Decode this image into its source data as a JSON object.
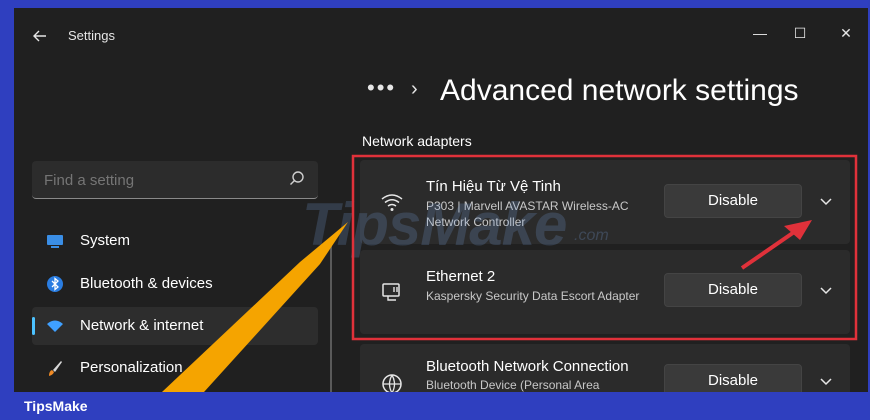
{
  "window": {
    "app_title": "Settings",
    "controls": {
      "minimize": "—",
      "maximize": "☐",
      "close": "✕"
    }
  },
  "sidebar": {
    "search_placeholder": "Find a setting",
    "items": [
      {
        "label": "System",
        "icon": "monitor-icon",
        "active": false
      },
      {
        "label": "Bluetooth & devices",
        "icon": "bluetooth-icon",
        "active": false
      },
      {
        "label": "Network & internet",
        "icon": "wifi-icon",
        "active": true
      },
      {
        "label": "Personalization",
        "icon": "brush-icon",
        "active": false
      }
    ]
  },
  "main": {
    "breadcrumb_more": "•••",
    "breadcrumb_sep": "›",
    "title": "Advanced network settings",
    "section": "Network adapters",
    "adapters": [
      {
        "name": "Tín Hiệu Từ Vệ Tinh",
        "description": "P303 | Marvell AVASTAR Wireless-AC Network Controller",
        "button": "Disable",
        "icon": "wifi-icon"
      },
      {
        "name": "Ethernet 2",
        "description": "Kaspersky Security Data Escort Adapter",
        "button": "Disable",
        "icon": "ethernet-icon"
      },
      {
        "name": "Bluetooth Network Connection",
        "description": "Bluetooth Device (Personal Area",
        "button": "Disable",
        "icon": "globe-icon"
      }
    ]
  },
  "watermark": {
    "text": "TipsMake",
    "suffix": ".com"
  },
  "brand": {
    "label": "TipsMake"
  },
  "colors": {
    "accent": "#4cc2ff",
    "highlight_box": "#e0313a",
    "arrow_orange": "#f5a400",
    "arrow_red": "#e0313a",
    "frame_blue": "#2f3fbf"
  }
}
